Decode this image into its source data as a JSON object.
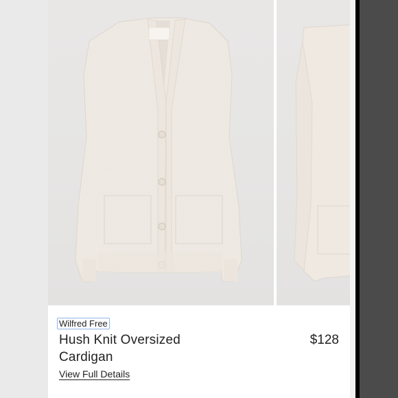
{
  "product": {
    "brand": "Wilfred Free",
    "title": "Hush Knit Oversized Cardigan",
    "price": "$128",
    "details_link": "View Full Details"
  },
  "gallery": {
    "images": [
      "cardigan-front-photo",
      "cardigan-side-photo"
    ]
  },
  "colors": {
    "background": "#ebeaea",
    "garment": "#f0ebe4",
    "text": "#222222"
  }
}
